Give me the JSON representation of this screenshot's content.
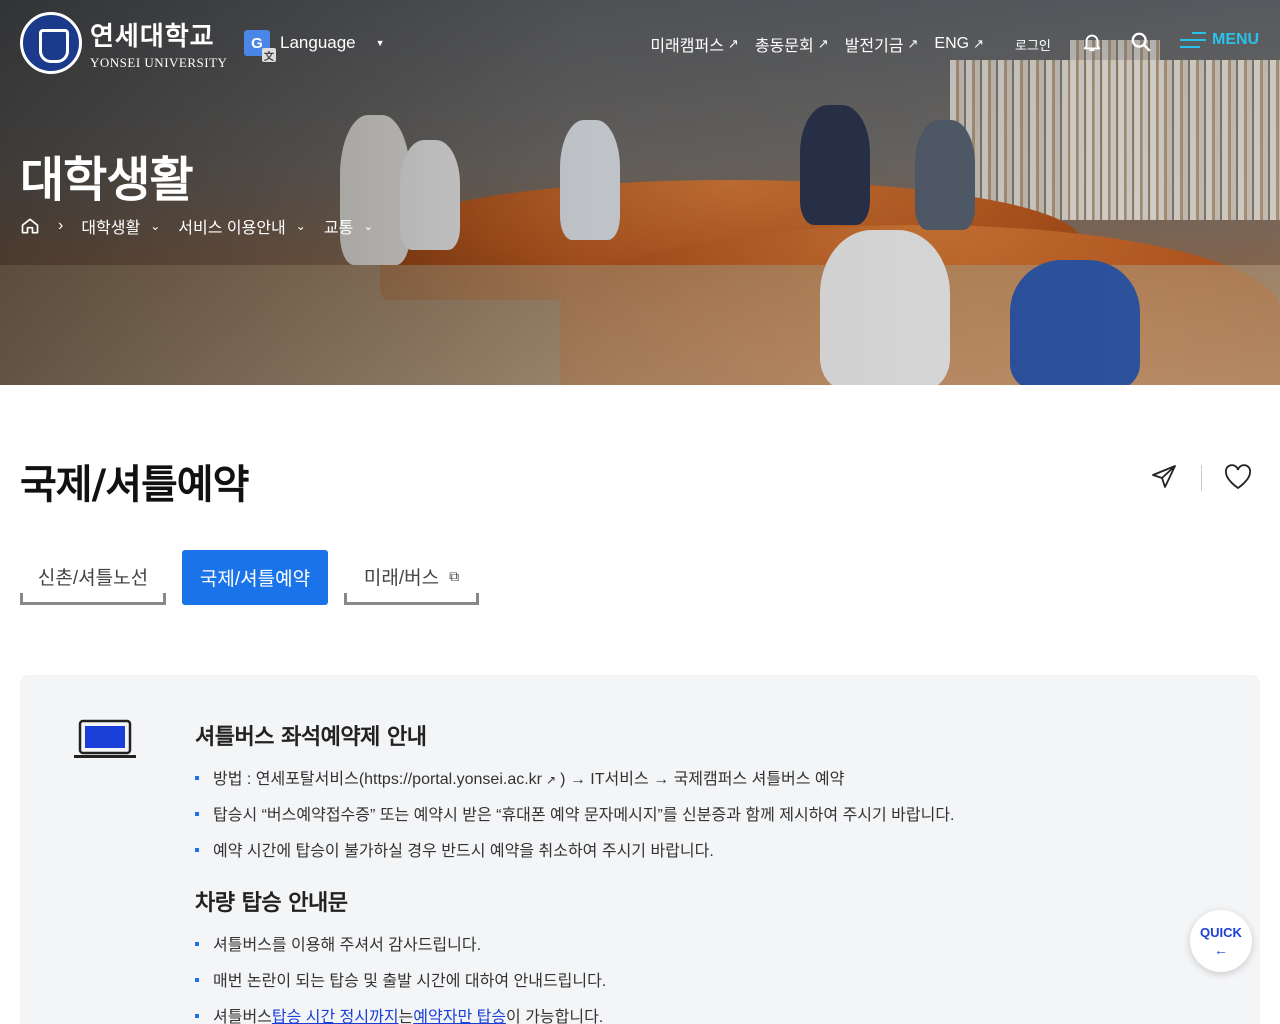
{
  "header": {
    "logo_ko": "연세대학교",
    "logo_en": "YONSEI UNIVERSITY",
    "language_label": "Language",
    "nav": [
      {
        "label": "미래캠퍼스",
        "icon": "external-arrow"
      },
      {
        "label": "총동문회",
        "icon": "external-arrow"
      },
      {
        "label": "발전기금",
        "icon": "external-arrow"
      },
      {
        "label": "ENG",
        "icon": "external-arrow"
      }
    ],
    "login_label": "로그인",
    "menu_label": "MENU",
    "menu_color": "#28c2ea"
  },
  "hero": {
    "title": "대학생활",
    "breadcrumb": [
      "대학생활",
      "서비스 이용안내",
      "교통"
    ]
  },
  "page": {
    "title": "국제/셔틀예약",
    "tabs": [
      {
        "label": "신촌/셔틀노선",
        "active": false
      },
      {
        "label": "국제/셔틀예약",
        "active": true
      },
      {
        "label": "미래/버스",
        "active": false,
        "external": true
      }
    ],
    "accent_color": "#1a73e8"
  },
  "notice": {
    "section1_title": "셔틀버스 좌석예약제 안내",
    "section1_items": [
      {
        "prefix": "방법 : 연세포탈서비스(https://portal.yonsei.ac.kr",
        "suffix": ") → IT서비스 → 국제캠퍼스 셔틀버스 예약"
      },
      {
        "text": "탑승시 “버스예약접수증” 또는 예약시 받은 “휴대폰 예약 문자메시지”를 신분증과 함께 제시하여 주시기 바랍니다."
      },
      {
        "text": "예약 시간에 탑승이 불가하실 경우 반드시 예약을 취소하여 주시기 바랍니다."
      }
    ],
    "section2_title": "차량 탑승 안내문",
    "section2_items": [
      {
        "text": "셔틀버스를 이용해 주셔서 감사드립니다."
      },
      {
        "text": "매번 논란이 되는 탑승 및 출발 시간에 대하여 안내드립니다."
      },
      {
        "p1": "셔틀버스 ",
        "link1": "탑승 시간 정시까지",
        "p2": "는 ",
        "link2": "예약자만 탑승",
        "p3": "이 가능합니다."
      }
    ]
  },
  "quick": {
    "label": "QUICK",
    "arrow": "←"
  }
}
